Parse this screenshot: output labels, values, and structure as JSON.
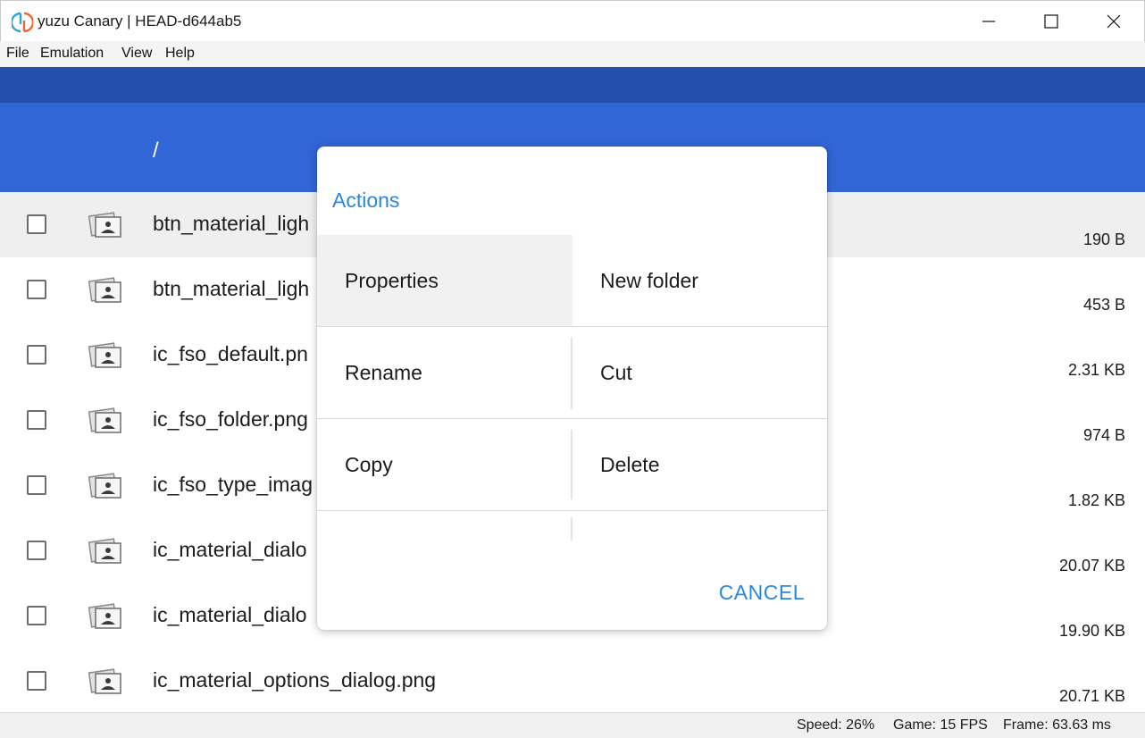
{
  "window": {
    "title": "yuzu Canary | HEAD-d644ab5",
    "icon": "yuzu-logo-icon",
    "controls": [
      "minimize-icon",
      "maximize-icon",
      "close-icon"
    ]
  },
  "menubar": {
    "items": [
      {
        "label": "File"
      },
      {
        "label": "Emulation"
      },
      {
        "label": "View"
      },
      {
        "label": "Help"
      }
    ]
  },
  "header": {
    "path": "/"
  },
  "files": [
    {
      "name": "btn_material_ligh",
      "size": "190 B",
      "highlighted": true
    },
    {
      "name": "btn_material_ligh",
      "size": "453 B"
    },
    {
      "name": "ic_fso_default.pn",
      "size": "2.31 KB"
    },
    {
      "name": "ic_fso_folder.png",
      "size": "974 B"
    },
    {
      "name": "ic_fso_type_imag",
      "size": "1.82 KB"
    },
    {
      "name": "ic_material_dialo",
      "size": "20.07 KB"
    },
    {
      "name": "ic_material_dialo",
      "size": "19.90 KB"
    },
    {
      "name": "ic_material_options_dialog.png",
      "size": "20.71 KB"
    }
  ],
  "dialog": {
    "title": "Actions",
    "actions": [
      {
        "label": "Properties",
        "pressed": true
      },
      {
        "label": "New folder"
      },
      {
        "label": "Rename"
      },
      {
        "label": "Cut"
      },
      {
        "label": "Copy"
      },
      {
        "label": "Delete"
      },
      {
        "label": ""
      },
      {
        "label": ""
      }
    ],
    "cancel_label": "CANCEL"
  },
  "statusbar": {
    "speed": "Speed: 26%",
    "game": "Game: 15 FPS",
    "frame": "Frame: 63.63 ms"
  },
  "colors": {
    "appbar_dark": "#2250ab",
    "appbar": "#3266d6",
    "accent": "#2b88d8"
  }
}
